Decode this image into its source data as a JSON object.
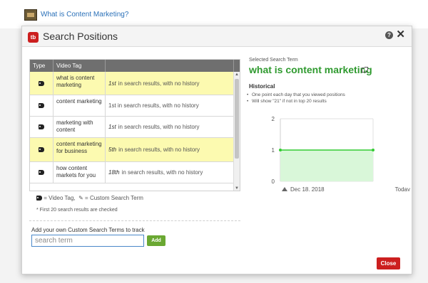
{
  "background": {
    "link_text": "What is Content Marketing?"
  },
  "modal": {
    "title": "Search Positions",
    "logo_text": "tb",
    "help_glyph": "?",
    "close_glyph": "✕"
  },
  "table": {
    "headers": {
      "type": "Type",
      "video_tag": "Video Tag",
      "position": ""
    },
    "rows": [
      {
        "tag": "what is content marketing",
        "rank": "1st",
        "status": "in search results, with no history",
        "highlighted": true
      },
      {
        "tag": "content marketing",
        "rank": "",
        "status": "1st in search results, with no history",
        "highlighted": false
      },
      {
        "tag": "marketing with content",
        "rank": "1st",
        "status": "in search results, with no history",
        "highlighted": false
      },
      {
        "tag": "content marketing for business",
        "rank": "5th",
        "status": "in search results, with no history",
        "highlighted": true
      },
      {
        "tag": "how content markets for you",
        "rank": "18th",
        "status": "in search results, with no history",
        "highlighted": false
      }
    ]
  },
  "legend": {
    "video_tag": "= Video Tag,",
    "custom_term": "= Custom Search Term",
    "note": "* First 20 search results are checked"
  },
  "custom": {
    "label": "Add your own Custom Search Terms to track",
    "placeholder": "search term",
    "add_label": "Add"
  },
  "selected": {
    "label": "Selected Search Term",
    "term": "what is content marketing",
    "historical_heading": "Historical",
    "bullets": [
      "One point each day that you viewed positions",
      "Will show \"21\" if not in top 20 results"
    ]
  },
  "chart_data": {
    "type": "line",
    "x": [
      "Dec 18, 2018",
      "Today"
    ],
    "series": [
      {
        "values": [
          1,
          1
        ]
      }
    ],
    "ylim": [
      0,
      2
    ],
    "yticks": [
      "2",
      "1",
      "0"
    ],
    "x_start_label": "Dec 18, 2018",
    "x_end_label": "Today",
    "colors": {
      "line": "#33cc33",
      "fill": "#d9f7d9"
    }
  },
  "footer": {
    "close_label": "Close"
  },
  "colors": {
    "brand_red": "#cc1f1f",
    "highlight": "#fcfab0",
    "term_green": "#2f9a2f",
    "add_green": "#6aa832"
  }
}
